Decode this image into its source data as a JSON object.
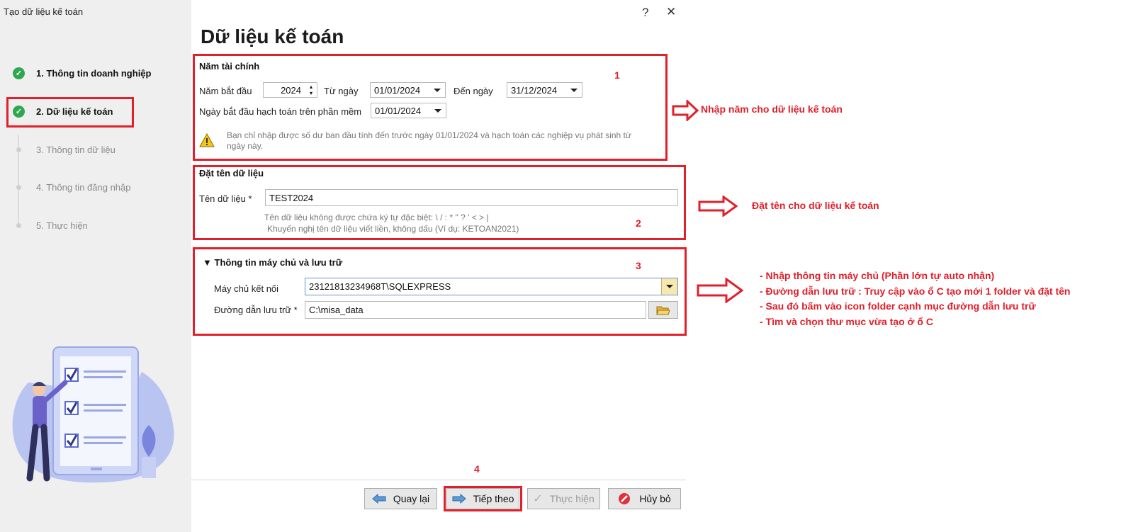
{
  "window": {
    "title": "Tạo dữ liệu kế toán",
    "help_label": "?",
    "close_label": "✕"
  },
  "steps": [
    {
      "label": "1. Thông tin doanh nghiệp",
      "state": "done"
    },
    {
      "label": "2. Dữ liệu kế toán",
      "state": "done"
    },
    {
      "label": "3. Thông tin dữ liệu",
      "state": "todo"
    },
    {
      "label": "4. Thông tin đăng nhập",
      "state": "todo"
    },
    {
      "label": "5. Thực hiện",
      "state": "todo"
    }
  ],
  "page_title": "Dữ liệu kế toán",
  "fiscal": {
    "section_title": "Năm tài chính",
    "start_year_label": "Năm bắt đầu",
    "start_year_value": "2024",
    "from_label": "Từ ngày",
    "from_value": "01/01/2024",
    "to_label": "Đến ngày",
    "to_value": "31/12/2024",
    "accounting_start_label": "Ngày bắt đầu hạch toán trên phần mềm",
    "accounting_start_value": "01/01/2024",
    "warning_text": "Bạn chỉ nhập được số dư ban đầu tính đến trước ngày 01/01/2024 và hạch toán các nghiệp vụ phát sinh từ ngày này."
  },
  "naming": {
    "section_title": "Đặt tên dữ liệu",
    "name_label": "Tên dữ liệu *",
    "name_value": "TEST2024",
    "hint_1": "Tên dữ liệu không được chứa ký tự đặc biệt: \\ / : * \" ? ' < > |",
    "hint_2": "Khuyến nghị tên dữ liệu viết liền, không dấu (Ví dụ: KETOAN2021)"
  },
  "server": {
    "section_title": "Thông tin máy chủ và lưu trữ",
    "server_label": "Máy chủ kết nối",
    "server_value": "23121813234968T\\SQLEXPRESS",
    "path_label": "Đường dẫn lưu trữ *",
    "path_value": "C:\\misa_data"
  },
  "buttons": {
    "back": "Quay lại",
    "next": "Tiếp theo",
    "execute": "Thực hiện",
    "cancel": "Hủy bỏ"
  },
  "annotations": {
    "num_1": "1",
    "num_2": "2",
    "num_3": "3",
    "num_4": "4",
    "note_1": "Nhập năm cho dữ liệu kế toán",
    "note_2": "Đặt tên cho dữ liệu kế toán",
    "note_3_lines": [
      "- Nhập thông tin máy chủ (Phần lớn tự auto nhận)",
      "- Đường dẫn lưu trữ : Truy cập vào ổ C tạo mới 1 folder và đặt tên",
      "- Sau đó bấm vào icon folder cạnh mục đường dẫn lưu trữ",
      "- Tìm và chọn thư mục vừa tạo ở ổ C"
    ]
  },
  "colors": {
    "annotation_red": "#e0202a",
    "done_green": "#2ea84f",
    "sidebar_bg": "#efefef"
  }
}
